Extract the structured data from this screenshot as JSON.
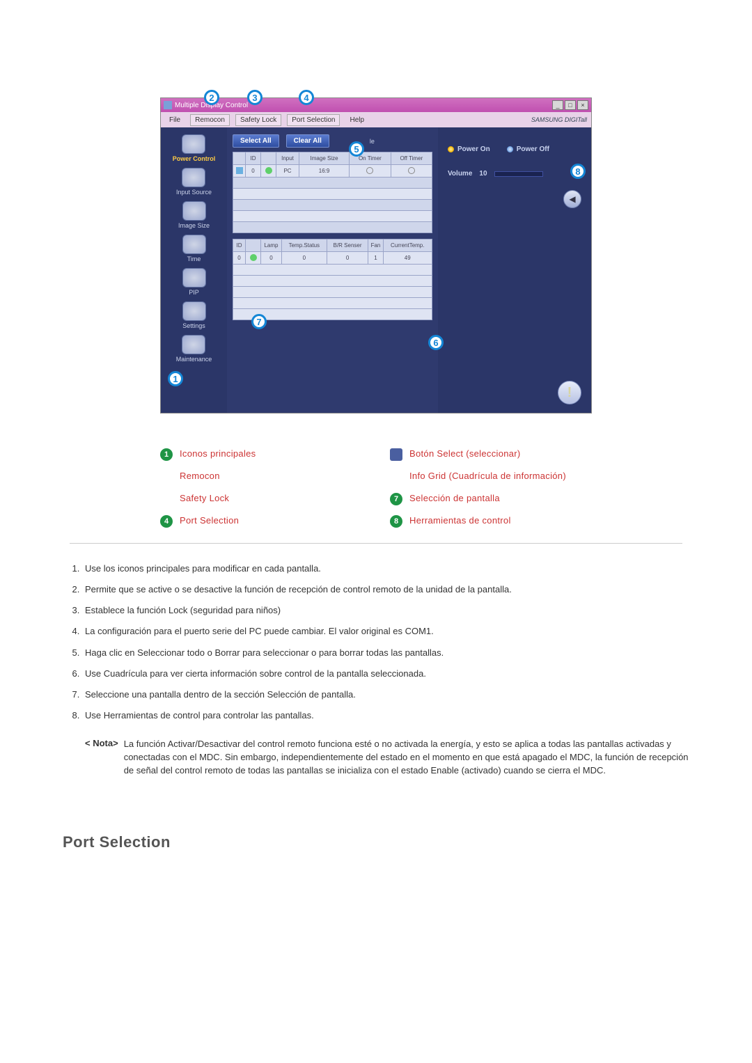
{
  "window": {
    "title": "Multiple Display Control",
    "brand": "SAMSUNG DIGITall",
    "winbtns": {
      "min": "_",
      "max": "□",
      "close": "×"
    }
  },
  "menu": {
    "file": "File",
    "remocon": "Remocon",
    "safety": "Safety Lock",
    "portsel": "Port Selection",
    "help": "Help"
  },
  "sidebar": {
    "items": [
      {
        "label": "Power Control",
        "highlight": true
      },
      {
        "label": "Input Source"
      },
      {
        "label": "Image Size"
      },
      {
        "label": "Time"
      },
      {
        "label": "PIP"
      },
      {
        "label": "Settings"
      },
      {
        "label": "Maintenance"
      }
    ]
  },
  "toolbar": {
    "select_all": "Select All",
    "clear_all": "Clear All",
    "suffix": "le"
  },
  "grid1": {
    "headers": [
      "",
      "ID",
      "",
      "Input",
      "Image Size",
      "On Timer",
      "Off Timer"
    ],
    "row": {
      "id": "0",
      "input": "PC",
      "ratio": "16:9"
    }
  },
  "grid2": {
    "headers": [
      "ID",
      "",
      "Lamp",
      "Temp.Status",
      "B/R Senser",
      "Fan",
      "CurrentTemp."
    ],
    "row": {
      "id": "0",
      "lamp": "0",
      "temp": "0",
      "br": "0",
      "fan": "1",
      "cur": "49"
    }
  },
  "controls": {
    "power_on": "Power On",
    "power_off": "Power Off",
    "volume_label": "Volume",
    "volume_value": "10"
  },
  "legend": {
    "1": "Iconos principales",
    "2": "Remocon",
    "3": "Safety Lock",
    "4": "Port Selection",
    "5": "Botón Select (seleccionar)",
    "6": "Info Grid (Cuadrícula de información)",
    "7": "Selección de pantalla",
    "8": "Herramientas de control"
  },
  "list": {
    "1": "Use los iconos principales para modificar en cada pantalla.",
    "2": "Permite que se active o se desactive la función de recepción de control remoto de la unidad de la pantalla.",
    "3": "Establece la función Lock (seguridad para niños)",
    "4": "La configuración para el puerto serie del PC puede cambiar. El valor original es COM1.",
    "5": "Haga clic en Seleccionar todo o Borrar para seleccionar o para borrar todas las pantallas.",
    "6": "Use Cuadrícula para ver cierta información sobre control de la pantalla seleccionada.",
    "7": "Seleccione una pantalla dentro de la sección Selección de pantalla.",
    "8": "Use Herramientas de control para controlar las pantallas.",
    "note_label": "< Nota>",
    "note_body": "La función Activar/Desactivar del control remoto funciona esté o no activada la energía, y esto se aplica a todas las pantallas activadas y conectadas con el MDC. Sin embargo, independientemente del estado en el momento en que está apagado el MDC, la función de recepción de señal del control remoto de todas las pantallas se inicializa con el estado Enable (activado) cuando se cierra el MDC."
  },
  "section_heading": "Port Selection"
}
